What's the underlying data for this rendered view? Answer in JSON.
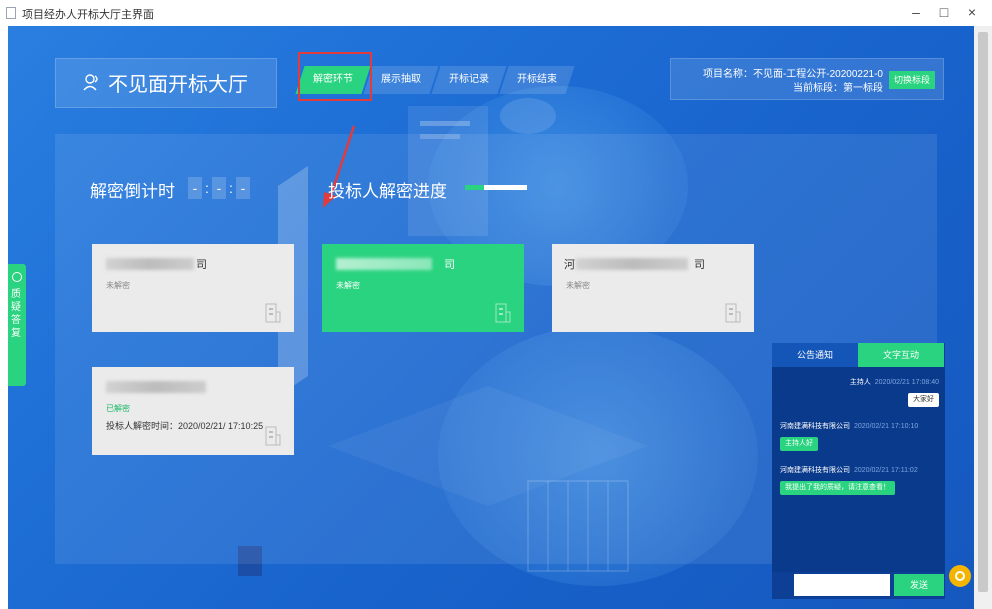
{
  "window": {
    "title": "项目经办人开标大厅主界面",
    "minimize": "–",
    "maximize": "□",
    "close": "×"
  },
  "header": {
    "hall_title": "不见面开标大厅",
    "tabs": [
      {
        "label": "解密环节",
        "active": true
      },
      {
        "label": "展示抽取",
        "active": false
      },
      {
        "label": "开标记录",
        "active": false
      },
      {
        "label": "开标结束",
        "active": false
      }
    ],
    "project_name": "项目名称：不见面-工程公开-20200221-0",
    "current_stage": "当前标段：第一标段",
    "switch_button": "切换标段"
  },
  "countdown": {
    "label": "解密倒计时",
    "cells": [
      "-",
      "-",
      "-"
    ],
    "separator": ":"
  },
  "progress": {
    "label": "投标人解密进度",
    "fraction": 0.3
  },
  "bidders": [
    {
      "name_suffix": "司",
      "status": "未解密",
      "highlighted": false,
      "decrypted": false
    },
    {
      "name_suffix": "司",
      "status": "未解密",
      "highlighted": true,
      "decrypted": false
    },
    {
      "name_prefix": "河",
      "name_suffix": "司",
      "status": "未解密",
      "highlighted": false,
      "decrypted": false
    },
    {
      "name_suffix": "",
      "status": "已解密",
      "time": "投标人解密时间：2020/02/21/ 17:10:25",
      "highlighted": false,
      "decrypted": true
    }
  ],
  "side_tab": {
    "label": "质疑答复"
  },
  "chat": {
    "tabs": [
      "公告通知",
      "文字互动"
    ],
    "messages": [
      {
        "sender": "主持人",
        "time": "2020/02/21 17:08:40",
        "text": "大家好",
        "mine": true
      },
      {
        "sender": "河南建满科技有限公司",
        "time": "2020/02/21 17:10:10",
        "text": "主持人好",
        "mine": false
      },
      {
        "sender": "河南建满科技有限公司",
        "time": "2020/02/21 17:11:02",
        "text": "我提出了我的质疑，请注意查看！",
        "mine": false
      }
    ],
    "input_placeholder": "",
    "send_button": "发送"
  },
  "colors": {
    "accent": "#2ad37f",
    "background": "#1e6fd6",
    "highlight_border": "#e23b3b",
    "fab": "#f5b400"
  },
  "icons": {
    "hall": "user-group-icon",
    "building": "building-icon",
    "side": "question-icon",
    "fab": "chat-icon",
    "arrow": "red-arrow-annotation"
  }
}
